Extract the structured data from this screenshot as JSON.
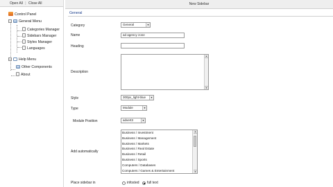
{
  "tree": {
    "open_all": "Open All",
    "separator": "|",
    "close_all": "Close All",
    "nodes": [
      {
        "label": "Control Panel",
        "icon": "control-panel-icon"
      },
      {
        "label": "General Menu",
        "icon": "folder-icon"
      },
      {
        "label": "Categories Manager",
        "icon": "page-icon"
      },
      {
        "label": "Sidebars Manager",
        "icon": "page-icon"
      },
      {
        "label": "Styles Manager",
        "icon": "page-icon"
      },
      {
        "label": "Languages",
        "icon": "page-icon"
      },
      {
        "label": "Help Menu",
        "icon": "folder-icon"
      },
      {
        "label": "Other Components",
        "icon": "folder-icon"
      },
      {
        "label": "About",
        "icon": "page-icon"
      }
    ]
  },
  "header": {
    "title": "New Sidebar"
  },
  "form": {
    "group_title": "General",
    "category": {
      "label": "Category",
      "value": "General"
    },
    "name": {
      "label": "Name",
      "value": "ad agency zone"
    },
    "heading": {
      "label": "Heading",
      "value": ""
    },
    "description": {
      "label": "Description",
      "value": ""
    },
    "style": {
      "label": "Style",
      "value": "300px_light-blue"
    },
    "type": {
      "label": "Type",
      "value": "Module"
    },
    "module_position": {
      "label": "Module Position",
      "value": "advert3"
    },
    "add_automatically": {
      "label": "Add automatically",
      "options": [
        "Business / Investment",
        "Business / Management",
        "Business / Markets",
        "Business / Real Estate",
        "Business / Retail",
        "Business / Sports",
        "Computers / Databases",
        "Computers / Games & Entertainment"
      ]
    },
    "place_sidebar": {
      "label": "Place sidebar in",
      "option_1": "infosted",
      "option_2": "full text",
      "selected": "full text"
    }
  }
}
